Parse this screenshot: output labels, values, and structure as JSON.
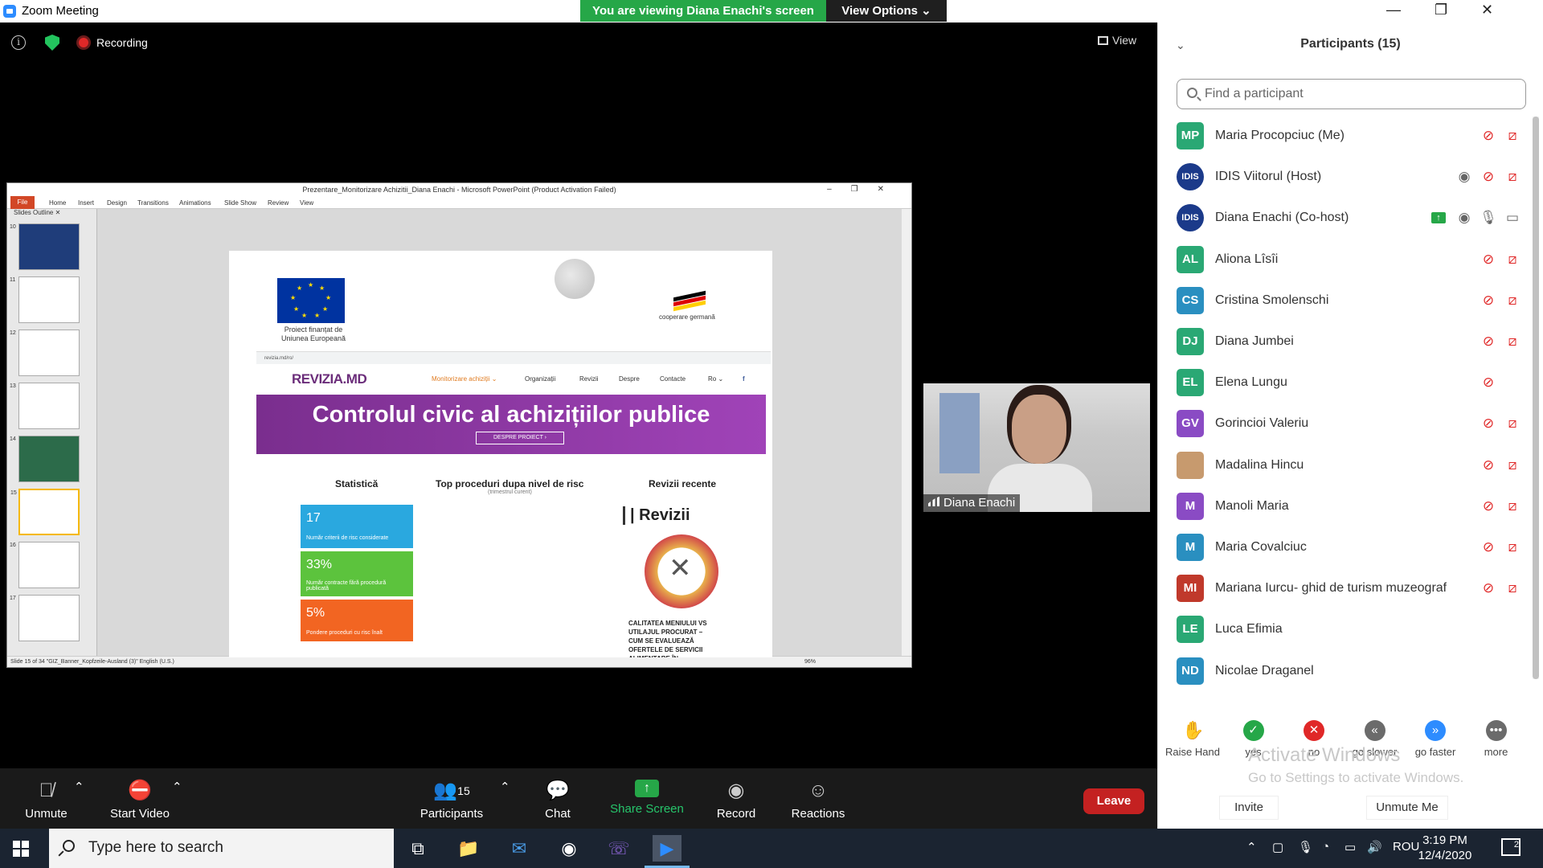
{
  "window": {
    "title": "Zoom Meeting",
    "viewing_banner": "You are viewing Diana Enachi's screen",
    "view_options": "View Options ⌄"
  },
  "meeting": {
    "recording_label": "Recording",
    "view_label": "View"
  },
  "ppt": {
    "window_title": "Prezentare_Monitorizare Achizitii_Diana Enachi - Microsoft PowerPoint (Product Activation Failed)",
    "ribbon_tabs": [
      "File",
      "Home",
      "Insert",
      "Design",
      "Transitions",
      "Animations",
      "Slide Show",
      "Review",
      "View"
    ],
    "panel_tabs": "Slides   Outline   ✕",
    "thumb_numbers": [
      "10",
      "11",
      "12",
      "13",
      "14",
      "15",
      "16",
      "17"
    ],
    "status_text": "Slide 15 of 34   \"GIZ_Banner_Kopfzeile-Ausland (3)\"   English (U.S.)",
    "zoom_level": "96%",
    "slide": {
      "eu_caption": "Proiect finanțat de Uniunea Europeană",
      "de_caption": "cooperare germană",
      "url": "revizia.md/ro/",
      "site_logo": "REVIZIA.MD",
      "nav_links": [
        "Monitorizare achiziții ⌄",
        "Organizații",
        "Revizii",
        "Despre",
        "Contacte",
        "Ro ⌄",
        "f"
      ],
      "hero_title": "Controlul civic al achizițiilor publice",
      "hero_button": "DESPRE PROIECT ›",
      "col_statistics": "Statistică",
      "col_top": "Top proceduri dupa nivel de risc",
      "col_top_sub": "(trimestrul curent)",
      "col_recent": "Revizii recente",
      "stats": [
        {
          "big": "17",
          "small": "Număr criterii de risc considerate",
          "color": "#2aa8df"
        },
        {
          "big": "33%",
          "small": "Număr contracte fără procedură publicată",
          "color": "#5cc33d"
        },
        {
          "big": "5%",
          "small": "Pondere proceduri cu risc înalt",
          "color": "#f26522"
        }
      ],
      "revizii_title": "| Revizii",
      "revizii_text": "CALITATEA MENIULUI VS UTILAJUL PROCURAT – CUM SE EVALUEAZĂ OFERTELE DE SERVICII ALIMENTARE ÎN"
    }
  },
  "speaker": {
    "name": "Diana Enachi"
  },
  "toolbar": {
    "unmute": "Unmute",
    "start_video": "Start Video",
    "participants": "Participants",
    "participants_count": "15",
    "chat": "Chat",
    "share_screen": "Share Screen",
    "record": "Record",
    "reactions": "Reactions",
    "leave": "Leave"
  },
  "panel": {
    "title": "Participants (15)",
    "search_placeholder": "Find a participant",
    "participants": [
      {
        "initials": "MP",
        "name": "Maria Procopciuc (Me)",
        "color": "#2aa874",
        "mic": "muted",
        "cam": "off"
      },
      {
        "initials": "IDIS",
        "name": "IDIS Viitorul (Host)",
        "color": "#1b3a8a",
        "mic": "muted",
        "cam": "off",
        "rec": true
      },
      {
        "initials": "IDIS",
        "name": "Diana Enachi (Co-host)",
        "color": "#1b3a8a",
        "mic": "on",
        "cam": "on",
        "rec": true,
        "share": true
      },
      {
        "initials": "AL",
        "name": "Aliona Lîsîi",
        "color": "#2aa874",
        "mic": "muted",
        "cam": "off"
      },
      {
        "initials": "CS",
        "name": "Cristina Smolenschi",
        "color": "#2a8fc0",
        "mic": "muted",
        "cam": "off"
      },
      {
        "initials": "DJ",
        "name": "Diana Jumbei",
        "color": "#2aa874",
        "mic": "muted",
        "cam": "off"
      },
      {
        "initials": "EL",
        "name": "Elena Lungu",
        "color": "#2aa874",
        "mic": "muted",
        "cam": "none"
      },
      {
        "initials": "GV",
        "name": "Gorincioi Valeriu",
        "color": "#8a4bc4",
        "mic": "muted",
        "cam": "off"
      },
      {
        "initials": "",
        "name": "Madalina Hincu",
        "color": "#c79a6e",
        "mic": "muted",
        "cam": "off"
      },
      {
        "initials": "M",
        "name": "Manoli Maria",
        "color": "#8a4bc4",
        "mic": "muted",
        "cam": "off"
      },
      {
        "initials": "M",
        "name": "Maria Covalciuc",
        "color": "#2a8fc0",
        "mic": "muted",
        "cam": "off"
      },
      {
        "initials": "MI",
        "name": "Mariana Iurcu- ghid de turism muzeograf",
        "color": "#c0392b",
        "mic": "muted",
        "cam": "off"
      },
      {
        "initials": "LE",
        "name": "Luca Efimia",
        "color": "#2aa874",
        "mic": "none",
        "cam": "none"
      },
      {
        "initials": "ND",
        "name": "Nicolae Draganel",
        "color": "#2a8fc0",
        "mic": "none",
        "cam": "none"
      }
    ],
    "reactions": [
      {
        "label": "Raise Hand",
        "glyph": "✋",
        "color": "#2d8cff"
      },
      {
        "label": "yes",
        "glyph": "✓",
        "color": "#26a748"
      },
      {
        "label": "no",
        "glyph": "✕",
        "color": "#e02828"
      },
      {
        "label": "go slower",
        "glyph": "«",
        "color": "#6b6b6b"
      },
      {
        "label": "go faster",
        "glyph": "»",
        "color": "#2d8cff"
      },
      {
        "label": "more",
        "glyph": "•••",
        "color": "#6b6b6b"
      }
    ],
    "activate_line1": "Activate Windows",
    "activate_line2": "Go to Settings to activate Windows.",
    "invite": "Invite",
    "unmute_me": "Unmute Me"
  },
  "taskbar": {
    "search_placeholder": "Type here to search",
    "language": "ROU",
    "time": "3:19 PM",
    "date": "12/4/2020",
    "notifications": "2"
  }
}
